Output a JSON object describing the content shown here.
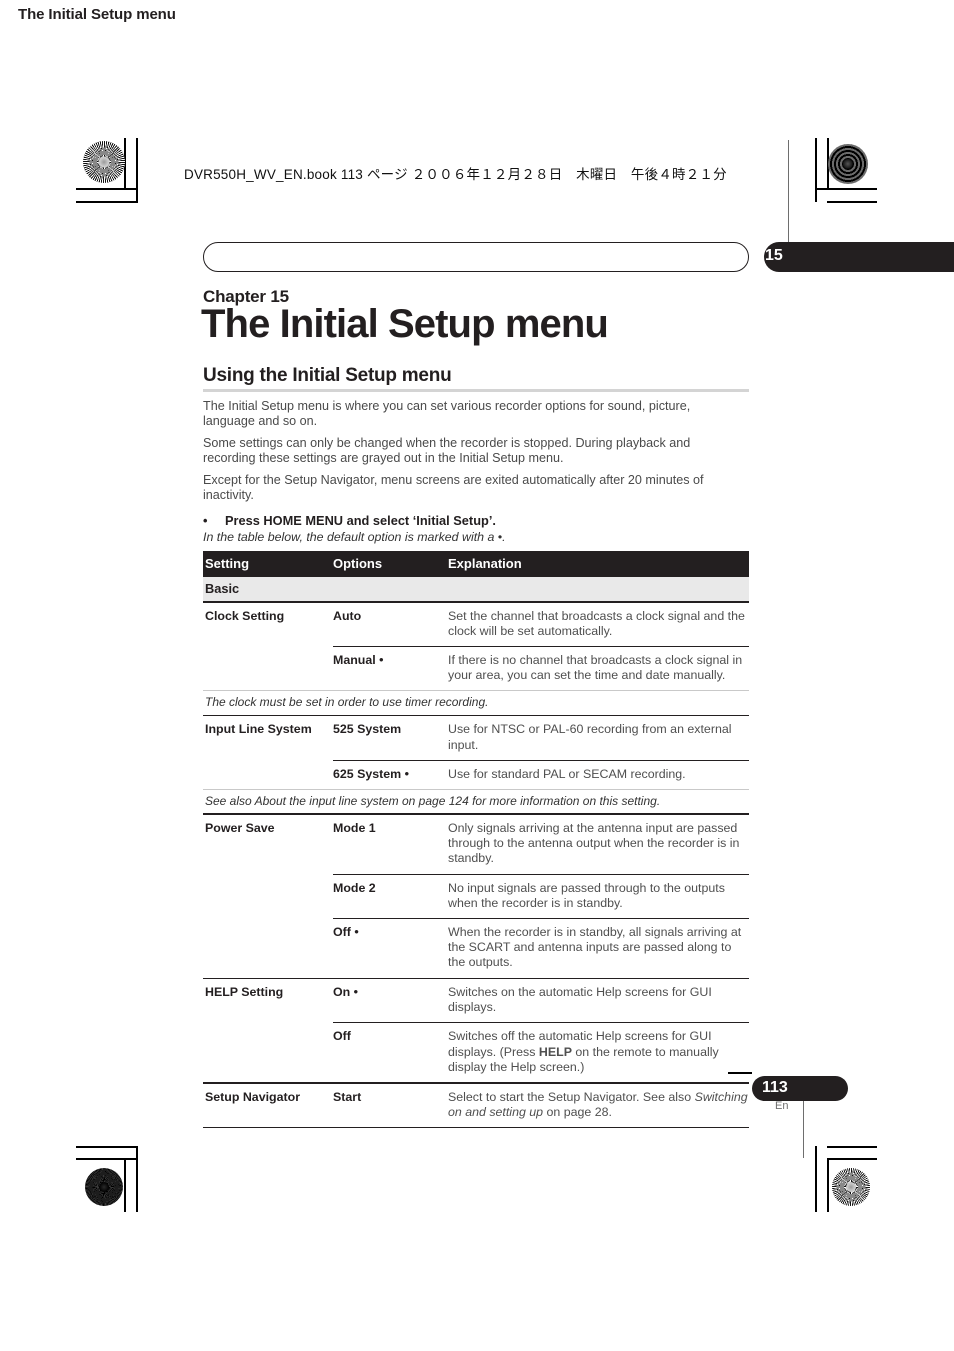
{
  "print_header": {
    "book_line": "DVR550H_WV_EN.book  113 ページ  ２００６年１２月２８日　木曜日　午後４時２１分"
  },
  "running_head": {
    "label": "The Initial Setup menu",
    "chapter_number": "15"
  },
  "title": {
    "kicker": "Chapter 15",
    "main": "The Initial Setup menu"
  },
  "section": {
    "heading": "Using the Initial Setup menu",
    "paragraphs": [
      "The Initial Setup menu is where you can set various recorder options for sound, picture, language and so on.",
      "Some settings can only be changed when the recorder is stopped. During playback and recording these settings are grayed out in the Initial Setup menu.",
      "Except for the Setup Navigator, menu screens are exited automatically after 20 minutes of inactivity."
    ],
    "bullet": "Press HOME MENU and select ‘Initial Setup’.",
    "bullet_marker": "•",
    "default_note": "In the table below, the default option is marked with a •."
  },
  "table": {
    "headers": {
      "setting": "Setting",
      "options": "Options",
      "explanation": "Explanation"
    },
    "section_label": "Basic",
    "rows": [
      {
        "setting": "Clock Setting",
        "option": "Auto",
        "explanation": "Set the channel that broadcasts a clock signal and the clock will be set automatically."
      },
      {
        "setting": "",
        "option": "Manual •",
        "explanation": "If there is no channel that broadcasts a clock signal in your area, you can set the time and date manually."
      },
      {
        "setting": "Input Line System",
        "option": "525 System",
        "explanation": "Use for NTSC or PAL-60 recording from an external input."
      },
      {
        "setting": "",
        "option": "625 System •",
        "explanation": "Use for standard PAL or SECAM recording."
      },
      {
        "setting": "Power Save",
        "option": "Mode 1",
        "explanation": "Only signals arriving at the antenna input are passed through to the antenna output when the recorder is in standby."
      },
      {
        "setting": "",
        "option": "Mode 2",
        "explanation": "No input signals are passed through to the outputs when the recorder is in standby."
      },
      {
        "setting": "",
        "option": "Off •",
        "explanation": "When the recorder is in standby, all signals arriving at the SCART and antenna inputs are passed along to the outputs."
      },
      {
        "setting": "HELP Setting",
        "option": "On •",
        "explanation": "Switches on the automatic Help screens for GUI displays."
      },
      {
        "setting": "",
        "option": "Off",
        "explanation_pre": "Switches off the automatic Help screens for GUI displays. (Press ",
        "explanation_bold": "HELP",
        "explanation_post": " on the remote to manually display the Help screen.)"
      },
      {
        "setting": "Setup Navigator",
        "option": "Start",
        "explanation_pre": "Select to start the Setup Navigator. See also ",
        "explanation_italic": "Switching on and setting up",
        "explanation_post": " on page 28."
      }
    ],
    "notes": {
      "clock": "The clock must be set in order to use timer recording.",
      "input_line": "See also About the input line system on page 124 for more information on this setting."
    }
  },
  "footer": {
    "page_number": "113",
    "language": "En"
  },
  "colors": {
    "ink": "#231f20",
    "body_text": "#4a4a4a",
    "subhead_band": "#e9e9e9",
    "rule_light": "#c9c9c9"
  }
}
